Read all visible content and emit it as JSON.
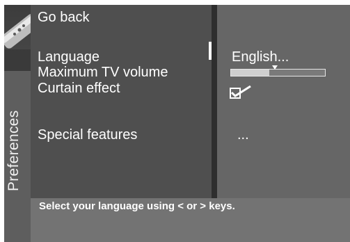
{
  "side_tab": {
    "label": "Preferences",
    "icon": "remote-control-icon"
  },
  "menu": {
    "items": [
      {
        "label": "Go back"
      },
      {
        "label": "Language"
      },
      {
        "label": "Maximum TV volume"
      },
      {
        "label": "Curtain effect"
      },
      {
        "label": "Special features"
      }
    ]
  },
  "values": {
    "language": "English...",
    "max_volume_level": 0.41,
    "curtain_effect_checked": true,
    "special_features": "..."
  },
  "status": {
    "text": "Select your language using < or > keys."
  },
  "colors": {
    "screen_bg": "#575757",
    "menu_bg": "#4f4f4f",
    "value_bg": "#666666",
    "status_bg": "#737373",
    "text": "#ffffff"
  }
}
